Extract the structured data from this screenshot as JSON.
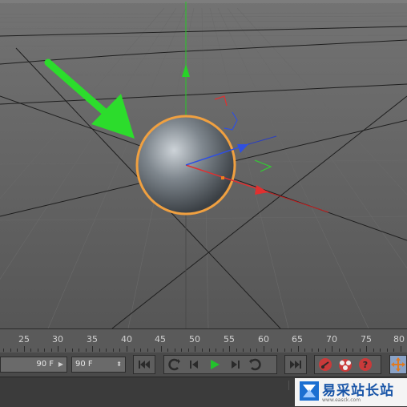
{
  "timeline": {
    "ticks": [
      "25",
      "30",
      "35",
      "40",
      "45",
      "50",
      "55",
      "60",
      "65",
      "70",
      "75",
      "80"
    ]
  },
  "controls": {
    "current_frame": "90 F",
    "end_frame": "90 F"
  },
  "watermark": {
    "brand": "易采站长站",
    "url": "www.easck.com"
  },
  "colors": {
    "selection_outline": "#f0a040",
    "annotation_arrow": "#2cdc2c",
    "axis_x": "#e03030",
    "axis_y": "#30d030",
    "axis_z": "#3050e0"
  },
  "icons": {
    "go_to_start": "skip-back-icon",
    "prev_keyframe": "loop-back-icon",
    "prev_frame": "step-back-icon",
    "play": "play-icon",
    "next_frame": "step-forward-icon",
    "next_keyframe": "loop-forward-icon",
    "go_to_end": "skip-forward-icon",
    "record": "record-icon",
    "autokey": "autokey-icon",
    "help": "help-icon",
    "move_tool": "move-icon"
  }
}
